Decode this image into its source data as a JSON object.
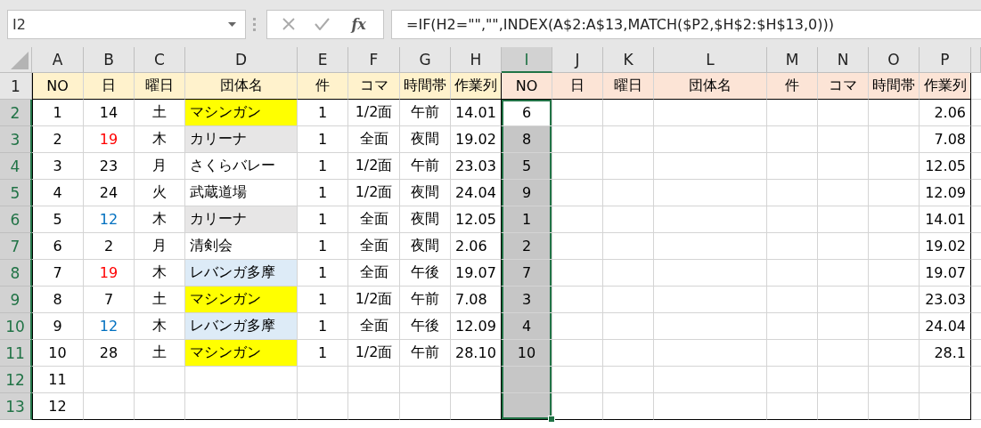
{
  "name_box": "I2",
  "fx_label": "fx",
  "formula": "=IF(H2=\"\",\"\",INDEX(A$2:A$13,MATCH($P2,$H$2:$H$13,0)))",
  "columns": [
    {
      "label": "A",
      "selected": false
    },
    {
      "label": "B",
      "selected": false
    },
    {
      "label": "C",
      "selected": false
    },
    {
      "label": "D",
      "selected": false
    },
    {
      "label": "E",
      "selected": false
    },
    {
      "label": "F",
      "selected": false
    },
    {
      "label": "G",
      "selected": false
    },
    {
      "label": "H",
      "selected": false
    },
    {
      "label": "I",
      "selected": true
    },
    {
      "label": "J",
      "selected": false
    },
    {
      "label": "K",
      "selected": false
    },
    {
      "label": "L",
      "selected": false
    },
    {
      "label": "M",
      "selected": false
    },
    {
      "label": "N",
      "selected": false
    },
    {
      "label": "O",
      "selected": false
    },
    {
      "label": "P",
      "selected": false
    }
  ],
  "header_row": {
    "number": "1",
    "selected": false,
    "cells": [
      {
        "text": "NO",
        "color": "#fff2cc"
      },
      {
        "text": "日",
        "color": "#fff2cc"
      },
      {
        "text": "曜日",
        "color": "#fff2cc"
      },
      {
        "text": "団体名",
        "color": "#fff2cc"
      },
      {
        "text": "件",
        "color": "#fff2cc"
      },
      {
        "text": "コマ",
        "color": "#fff2cc"
      },
      {
        "text": "時間帯",
        "color": "#fff2cc"
      },
      {
        "text": "作業列",
        "color": "#fff2cc"
      },
      {
        "text": "NO",
        "color": "#fce4d6"
      },
      {
        "text": "日",
        "color": "#fce4d6"
      },
      {
        "text": "曜日",
        "color": "#fce4d6"
      },
      {
        "text": "団体名",
        "color": "#fce4d6"
      },
      {
        "text": "件",
        "color": "#fce4d6"
      },
      {
        "text": "コマ",
        "color": "#fce4d6"
      },
      {
        "text": "時間帯",
        "color": "#fce4d6"
      },
      {
        "text": "作業列",
        "color": "#fce4d6"
      }
    ]
  },
  "rows": [
    {
      "number": "2",
      "selected": true,
      "cells": [
        {
          "text": "1"
        },
        {
          "text": "14"
        },
        {
          "text": "土"
        },
        {
          "text": "マシンガン",
          "color": "#ffff00"
        },
        {
          "text": "1"
        },
        {
          "text": "1/2面"
        },
        {
          "text": "午前"
        },
        {
          "text": "14.01"
        },
        {
          "text": "6",
          "selected": true,
          "active": true
        },
        {},
        {},
        {},
        {},
        {},
        {},
        {
          "text": "2.06"
        }
      ]
    },
    {
      "number": "3",
      "selected": true,
      "cells": [
        {
          "text": "2"
        },
        {
          "text": "19",
          "color": "#ff0000",
          "kind": "font"
        },
        {
          "text": "木"
        },
        {
          "text": "カリーナ",
          "color": "#e7e6e6"
        },
        {
          "text": "1"
        },
        {
          "text": "全面"
        },
        {
          "text": "夜間"
        },
        {
          "text": "19.02"
        },
        {
          "text": "8",
          "selected": true,
          "active": false
        },
        {},
        {},
        {},
        {},
        {},
        {},
        {
          "text": "7.08"
        }
      ]
    },
    {
      "number": "4",
      "selected": true,
      "cells": [
        {
          "text": "3"
        },
        {
          "text": "23"
        },
        {
          "text": "月"
        },
        {
          "text": "さくらバレー"
        },
        {
          "text": "1"
        },
        {
          "text": "1/2面"
        },
        {
          "text": "午前"
        },
        {
          "text": "23.03"
        },
        {
          "text": "5",
          "selected": true,
          "active": false
        },
        {},
        {},
        {},
        {},
        {},
        {},
        {
          "text": "12.05"
        }
      ]
    },
    {
      "number": "5",
      "selected": true,
      "cells": [
        {
          "text": "4"
        },
        {
          "text": "24"
        },
        {
          "text": "火"
        },
        {
          "text": "武蔵道場"
        },
        {
          "text": "1"
        },
        {
          "text": "1/2面"
        },
        {
          "text": "夜間"
        },
        {
          "text": "24.04"
        },
        {
          "text": "9",
          "selected": true,
          "active": false
        },
        {},
        {},
        {},
        {},
        {},
        {},
        {
          "text": "12.09"
        }
      ]
    },
    {
      "number": "6",
      "selected": true,
      "cells": [
        {
          "text": "5"
        },
        {
          "text": "12",
          "color": "#0070c0",
          "kind": "font"
        },
        {
          "text": "木"
        },
        {
          "text": "カリーナ",
          "color": "#e7e6e6"
        },
        {
          "text": "1"
        },
        {
          "text": "全面"
        },
        {
          "text": "夜間"
        },
        {
          "text": "12.05"
        },
        {
          "text": "1",
          "selected": true,
          "active": false
        },
        {},
        {},
        {},
        {},
        {},
        {},
        {
          "text": "14.01"
        }
      ]
    },
    {
      "number": "7",
      "selected": true,
      "cells": [
        {
          "text": "6"
        },
        {
          "text": "2"
        },
        {
          "text": "月"
        },
        {
          "text": "清剣会"
        },
        {
          "text": "1"
        },
        {
          "text": "全面"
        },
        {
          "text": "夜間"
        },
        {
          "text": "2.06"
        },
        {
          "text": "2",
          "selected": true,
          "active": false
        },
        {},
        {},
        {},
        {},
        {},
        {},
        {
          "text": "19.02"
        }
      ]
    },
    {
      "number": "8",
      "selected": true,
      "cells": [
        {
          "text": "7"
        },
        {
          "text": "19",
          "color": "#ff0000",
          "kind": "font"
        },
        {
          "text": "木"
        },
        {
          "text": "レバンガ多摩",
          "color": "#ddebf7"
        },
        {
          "text": "1"
        },
        {
          "text": "全面"
        },
        {
          "text": "午後"
        },
        {
          "text": "19.07"
        },
        {
          "text": "7",
          "selected": true,
          "active": false
        },
        {},
        {},
        {},
        {},
        {},
        {},
        {
          "text": "19.07"
        }
      ]
    },
    {
      "number": "9",
      "selected": true,
      "cells": [
        {
          "text": "8"
        },
        {
          "text": "7"
        },
        {
          "text": "土"
        },
        {
          "text": "マシンガン",
          "color": "#ffff00"
        },
        {
          "text": "1"
        },
        {
          "text": "1/2面"
        },
        {
          "text": "午前"
        },
        {
          "text": "7.08"
        },
        {
          "text": "3",
          "selected": true,
          "active": false
        },
        {},
        {},
        {},
        {},
        {},
        {},
        {
          "text": "23.03"
        }
      ]
    },
    {
      "number": "10",
      "selected": true,
      "cells": [
        {
          "text": "9"
        },
        {
          "text": "12",
          "color": "#0070c0",
          "kind": "font"
        },
        {
          "text": "木"
        },
        {
          "text": "レバンガ多摩",
          "color": "#ddebf7"
        },
        {
          "text": "1"
        },
        {
          "text": "全面"
        },
        {
          "text": "午後"
        },
        {
          "text": "12.09"
        },
        {
          "text": "4",
          "selected": true,
          "active": false
        },
        {},
        {},
        {},
        {},
        {},
        {},
        {
          "text": "24.04"
        }
      ]
    },
    {
      "number": "11",
      "selected": true,
      "cells": [
        {
          "text": "10"
        },
        {
          "text": "28"
        },
        {
          "text": "土"
        },
        {
          "text": "マシンガン",
          "color": "#ffff00"
        },
        {
          "text": "1"
        },
        {
          "text": "1/2面"
        },
        {
          "text": "午前"
        },
        {
          "text": "28.10"
        },
        {
          "text": "10",
          "selected": true,
          "active": false
        },
        {},
        {},
        {},
        {},
        {},
        {},
        {
          "text": "28.1"
        }
      ]
    },
    {
      "number": "12",
      "selected": true,
      "cells": [
        {
          "text": "11"
        },
        {},
        {},
        {},
        {},
        {},
        {},
        {},
        {
          "selected": true,
          "active": false
        },
        {},
        {},
        {},
        {},
        {},
        {},
        {}
      ]
    },
    {
      "number": "13",
      "selected": true,
      "cells": [
        {
          "text": "12"
        },
        {},
        {},
        {},
        {},
        {},
        {},
        {},
        {
          "selected": true,
          "active": false
        },
        {},
        {},
        {},
        {},
        {},
        {},
        {}
      ]
    }
  ]
}
